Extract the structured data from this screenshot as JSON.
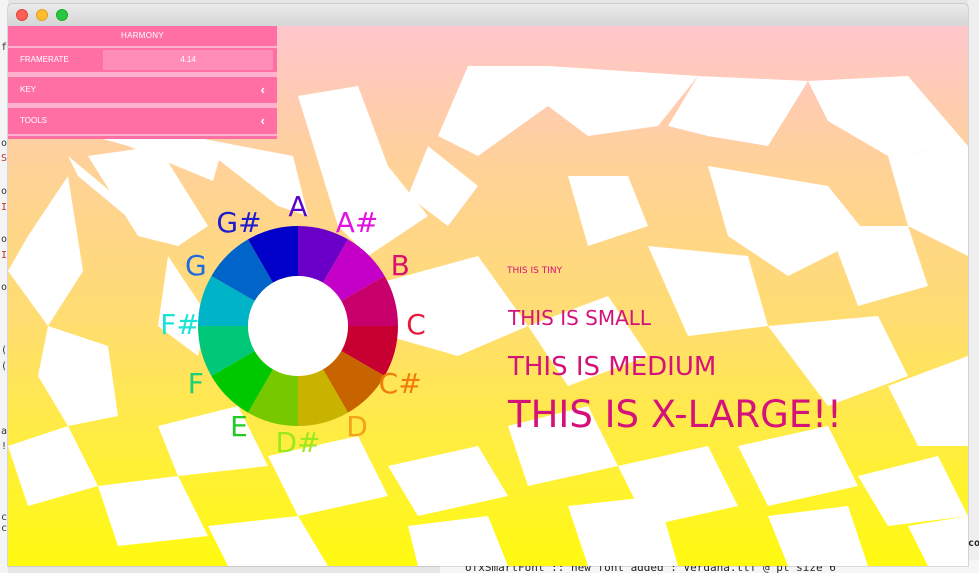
{
  "ide": {
    "gutter": [
      "f",
      "o",
      "S",
      "o",
      "I",
      "o",
      "I",
      "o",
      "(",
      "(",
      "a",
      "!",
      "c",
      "c"
    ],
    "console_line": "ofxSmartFont :: new font added : Verdana.ttf @ pt size 6",
    "right_fragment": "co"
  },
  "gui": {
    "title": "HARMONY",
    "framerate_label": "FRAMERATE",
    "framerate_value": "4.14",
    "key_label": "KEY",
    "tools_label": "TOOLS",
    "chevron_icon": "chevron-left-icon"
  },
  "colors": {
    "panel": "#ff6fa4",
    "text_magenta": "#d4127a"
  },
  "wheel": {
    "notes": [
      {
        "name": "A",
        "color": "#5a06c8"
      },
      {
        "name": "A#",
        "color": "#e213e2"
      },
      {
        "name": "B",
        "color": "#d9126a"
      },
      {
        "name": "C",
        "color": "#e8193c"
      },
      {
        "name": "C#",
        "color": "#f07c0a"
      },
      {
        "name": "D",
        "color": "#f3a21a"
      },
      {
        "name": "D#",
        "color": "#9be81c"
      },
      {
        "name": "E",
        "color": "#20cc22"
      },
      {
        "name": "F",
        "color": "#1ad075"
      },
      {
        "name": "F#",
        "color": "#1ae4d8"
      },
      {
        "name": "G",
        "color": "#1f6ce0"
      },
      {
        "name": "G#",
        "color": "#1e1ccc"
      }
    ],
    "segment_colors": [
      "#6a00c8",
      "#c400c8",
      "#c8006c",
      "#c80032",
      "#c86400",
      "#c8b400",
      "#78c800",
      "#00c800",
      "#00c878",
      "#00b4c8",
      "#0064c8",
      "#0000c8"
    ]
  },
  "samples": [
    {
      "text": "THIS IS TINY"
    },
    {
      "text": "THIS IS SMALL"
    },
    {
      "text": "THIS IS MEDIUM"
    },
    {
      "text": "THIS IS X-LARGE!!"
    }
  ]
}
